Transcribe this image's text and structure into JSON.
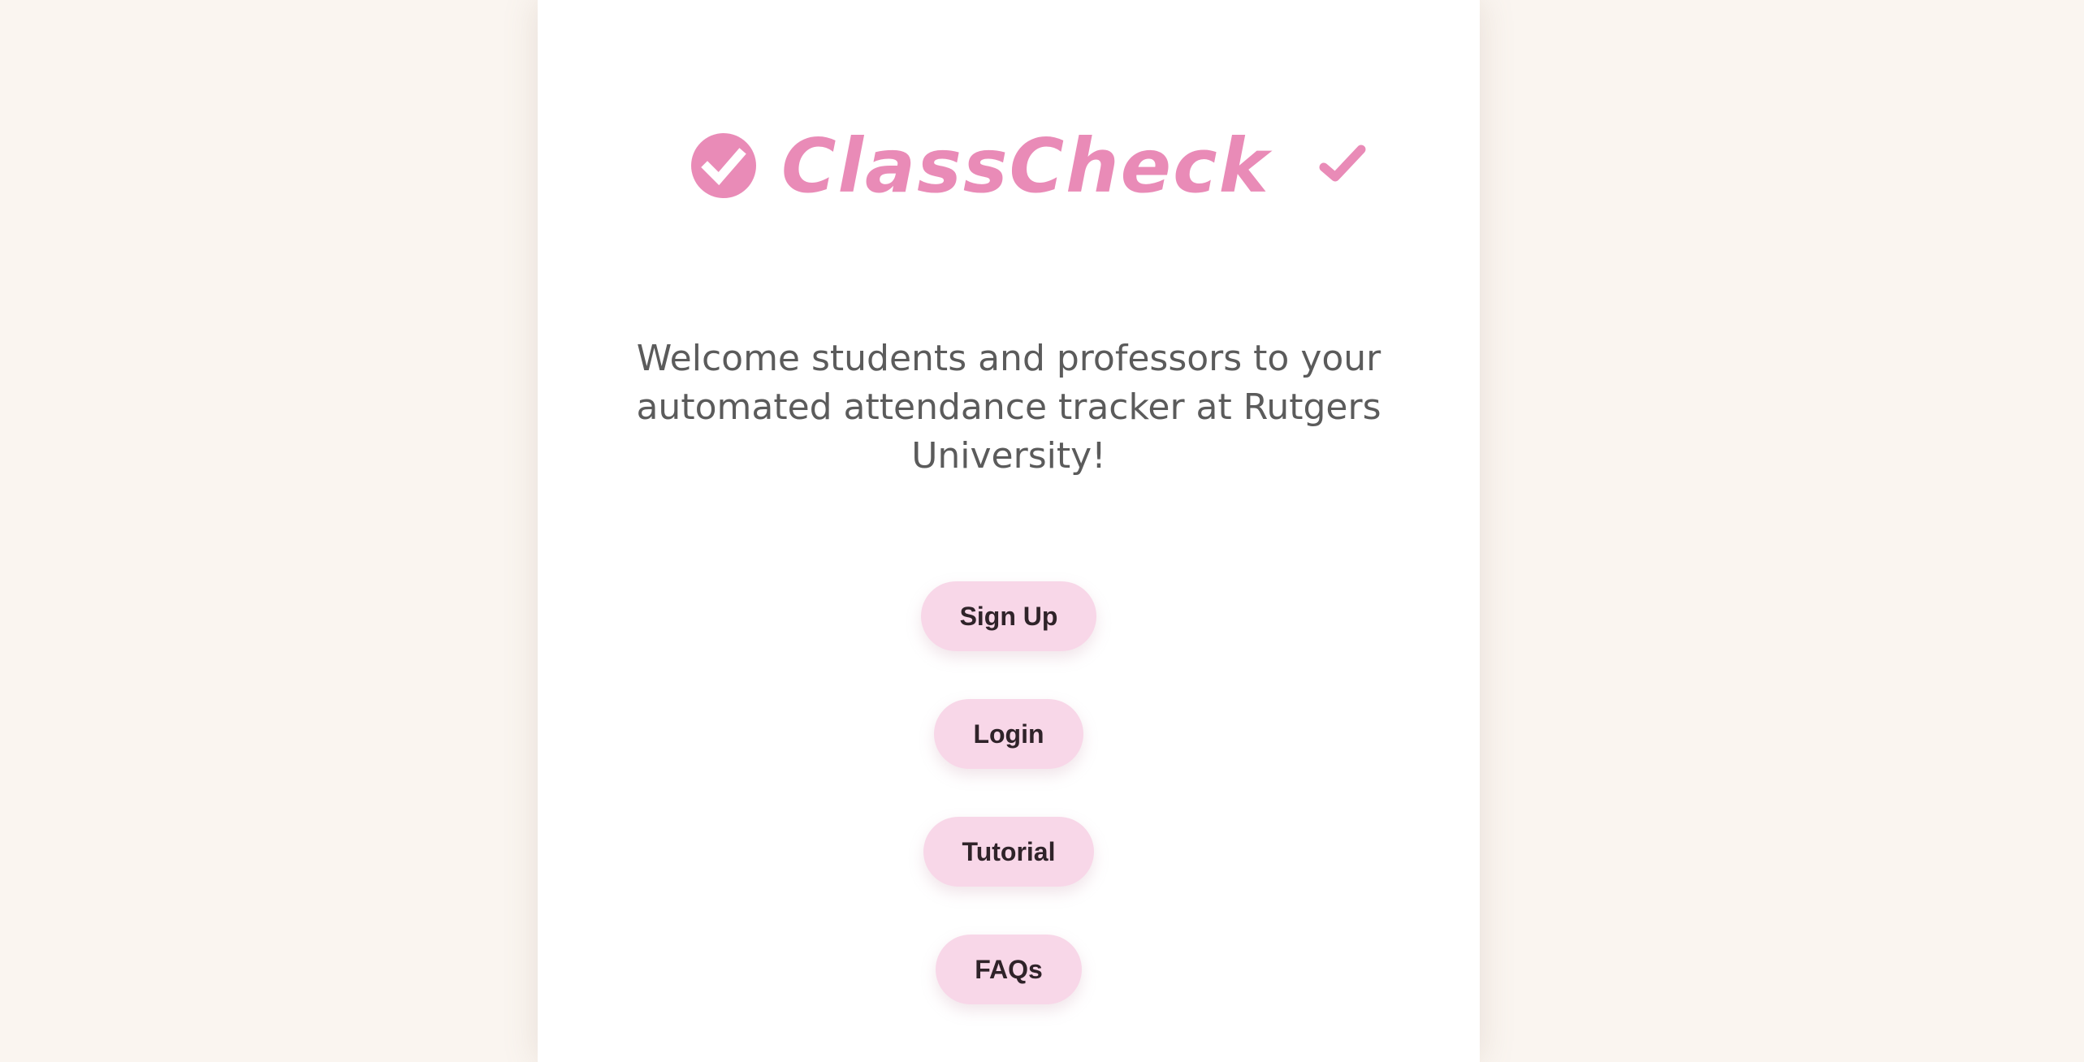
{
  "brand": {
    "name": "ClassCheck",
    "logo_icon": "check-circle-icon",
    "trailing_icon": "check-icon"
  },
  "welcome": {
    "message": "Welcome students and professors to your automated attendance tracker at Rutgers University!"
  },
  "buttons": {
    "signup": "Sign Up",
    "login": "Login",
    "tutorial": "Tutorial",
    "faqs": "FAQs"
  },
  "colors": {
    "brand": "#e98bb7",
    "button_bg": "#f8d7e8",
    "button_text": "#2f2329",
    "page_bg": "#faf5f0",
    "card_bg": "#ffffff",
    "body_text": "#5b5b5b"
  }
}
